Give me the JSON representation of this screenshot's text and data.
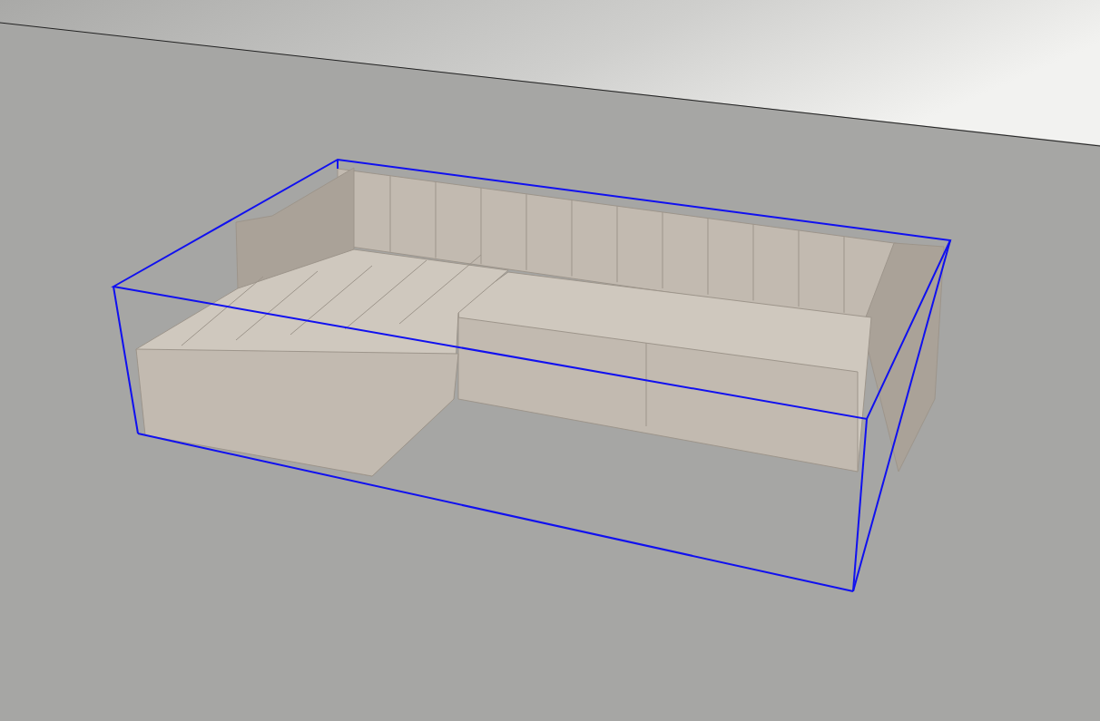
{
  "viewport": {
    "selected": true
  }
}
